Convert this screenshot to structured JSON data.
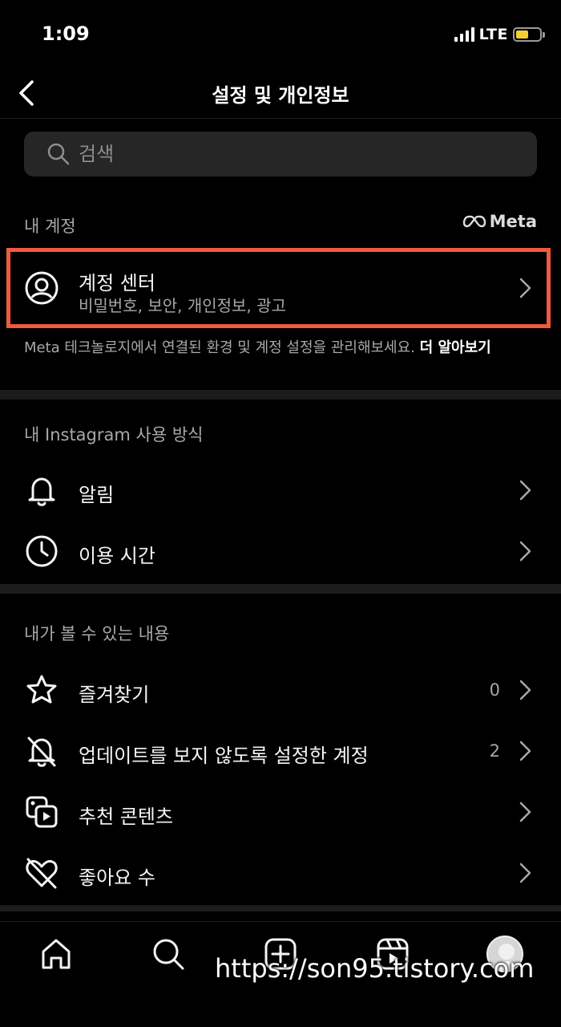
{
  "status": {
    "time": "1:09",
    "network": "LTE",
    "battery_level": 0.55
  },
  "header": {
    "title": "설정 및 개인정보"
  },
  "search": {
    "placeholder": "검색"
  },
  "account_section": {
    "title": "내 계정",
    "brand": "Meta",
    "account_center": {
      "title": "계정 센터",
      "subtitle": "비밀번호, 보안, 개인정보, 광고"
    },
    "note": "Meta 테크놀로지에서 연결된 환경 및 계정 설정을 관리해보세요.",
    "note_link": "더 알아보기"
  },
  "usage_section": {
    "title": "내 Instagram 사용 방식",
    "items": [
      {
        "label": "알림",
        "icon": "bell-icon"
      },
      {
        "label": "이용 시간",
        "icon": "clock-icon"
      }
    ]
  },
  "content_section": {
    "title": "내가 볼 수 있는 내용",
    "items": [
      {
        "label": "즐겨찾기",
        "count": "0",
        "icon": "star-icon"
      },
      {
        "label": "업데이트를 보지 않도록 설정한 계정",
        "count": "2",
        "icon": "muted-bell-icon"
      },
      {
        "label": "추천 콘텐츠",
        "icon": "suggested-content-icon"
      },
      {
        "label": "좋아요 수",
        "icon": "hidden-like-icon"
      }
    ]
  },
  "tab_bar": {
    "items": [
      "home-icon",
      "search-icon",
      "create-icon",
      "reels-icon",
      "profile-avatar"
    ]
  },
  "watermark": "https://son95.tistory.com",
  "colors": {
    "highlight": "#f05a3c",
    "background": "#000000",
    "battery": "#f2d12e"
  }
}
